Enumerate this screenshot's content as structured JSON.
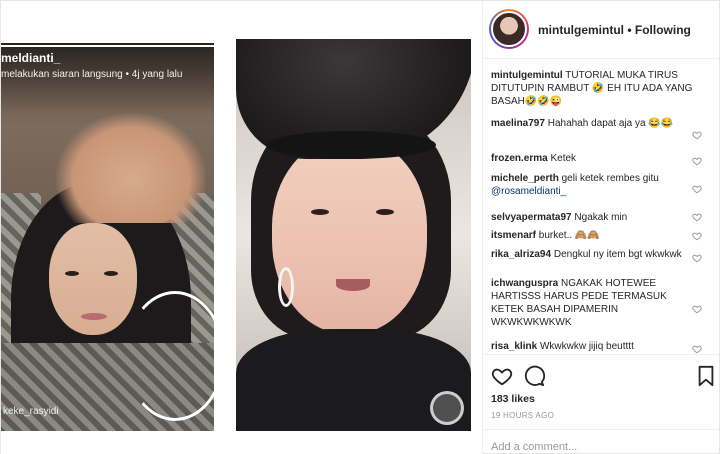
{
  "media": {
    "live_user": "meldianti_",
    "live_subtitle": "melakukan siaran langsung • 4j yang lalu",
    "left_tag": "keke_rasyidi",
    "live_progress": 1.0
  },
  "header": {
    "username": "mintulgemintul",
    "separator": "•",
    "follow_status": "Following"
  },
  "caption": {
    "username": "mintulgemintul",
    "text": "TUTORIAL MUKA TIRUS DITUTUPIN RAMBUT 🤣 EH ITU ADA YANG BASAH🤣🤣😜"
  },
  "comments": [
    {
      "username": "maelina797",
      "text": "Hahahah dapat aja ya 😂😂"
    },
    {
      "username": "frozen.erma",
      "text": "Ketek"
    },
    {
      "username": "michele_perth",
      "text": "geli ketek rembes gitu",
      "mention": "@rosameldianti_"
    },
    {
      "username": "selvyapermata97",
      "text": "Ngakak min"
    },
    {
      "username": "itsmenarf",
      "text": "burket.. 🙈🙈"
    },
    {
      "username": "rika_alriza94",
      "text": "Dengkul ny item bgt wkwkwk"
    },
    {
      "username": "ichwanguspra",
      "text": "NGAKAK HOTEWEE HARTISSS HARUS PEDE TERMASUK KETEK BASAH DIPAMERIN WKWKWKWKWK"
    },
    {
      "username": "risa_klink",
      "text": "Wkwkwkw jijiq beutttt"
    }
  ],
  "likes": "183 likes",
  "timestamp": "19 HOURS AGO",
  "add_comment_placeholder": "Add a comment...",
  "colors": {
    "link": "#003569",
    "muted": "#999999",
    "text": "#262626",
    "border": "#efefef"
  }
}
